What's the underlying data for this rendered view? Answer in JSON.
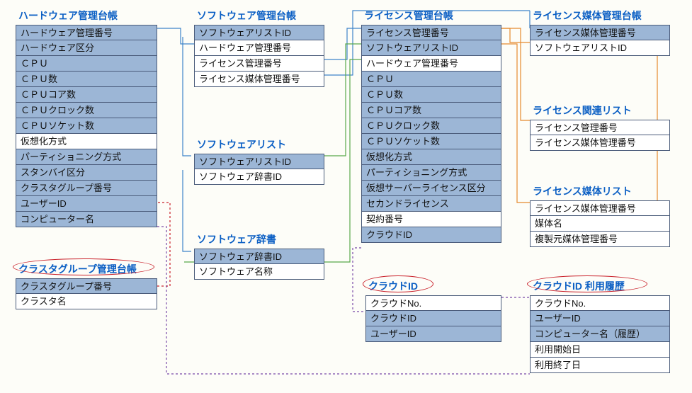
{
  "entities": {
    "hardware_ledger": {
      "title": "ハードウェア管理台帳",
      "fields": [
        {
          "label": "ハードウェア管理番号",
          "key": true
        },
        {
          "label": "ハードウェア区分",
          "key": true
        },
        {
          "label": "ＣＰＵ",
          "key": true
        },
        {
          "label": "ＣＰＵ数",
          "key": true
        },
        {
          "label": "ＣＰＵコア数",
          "key": true
        },
        {
          "label": "ＣＰＵクロック数",
          "key": true
        },
        {
          "label": "ＣＰＵソケット数",
          "key": true
        },
        {
          "label": "仮想化方式",
          "key": false
        },
        {
          "label": "パーティショニング方式",
          "key": true
        },
        {
          "label": "スタンバイ区分",
          "key": true
        },
        {
          "label": "クラスタグループ番号",
          "key": true
        },
        {
          "label": "ユーザーID",
          "key": true
        },
        {
          "label": "コンピューター名",
          "key": true
        }
      ]
    },
    "software_ledger": {
      "title": "ソフトウェア管理台帳",
      "fields": [
        {
          "label": "ソフトウェアリストID",
          "key": true
        },
        {
          "label": "ハードウェア管理番号",
          "key": false
        },
        {
          "label": "ライセンス管理番号",
          "key": false
        },
        {
          "label": "ライセンス媒体管理番号",
          "key": false
        }
      ]
    },
    "software_list": {
      "title": "ソフトウェアリスト",
      "fields": [
        {
          "label": "ソフトウェアリストID",
          "key": true
        },
        {
          "label": "ソフトウェア辞書ID",
          "key": false
        }
      ]
    },
    "software_dict": {
      "title": "ソフトウェア辞書",
      "fields": [
        {
          "label": "ソフトウェア辞書ID",
          "key": true
        },
        {
          "label": "ソフトウェア名称",
          "key": false
        }
      ]
    },
    "cluster_group": {
      "title": "クラスタグループ管理台帳",
      "fields": [
        {
          "label": "クラスタグループ番号",
          "key": true
        },
        {
          "label": "クラスタ名",
          "key": false
        }
      ]
    },
    "license_ledger": {
      "title": "ライセンス管理台帳",
      "fields": [
        {
          "label": "ライセンス管理番号",
          "key": true
        },
        {
          "label": "ソフトウェアリストID",
          "key": true
        },
        {
          "label": "ハードウェア管理番号",
          "key": false
        },
        {
          "label": "ＣＰＵ",
          "key": true
        },
        {
          "label": "ＣＰＵ数",
          "key": true
        },
        {
          "label": "ＣＰＵコア数",
          "key": true
        },
        {
          "label": "ＣＰＵクロック数",
          "key": true
        },
        {
          "label": "ＣＰＵソケット数",
          "key": true
        },
        {
          "label": "仮想化方式",
          "key": true
        },
        {
          "label": "パーティショニング方式",
          "key": true
        },
        {
          "label": "仮想サーバーライセンス区分",
          "key": true
        },
        {
          "label": "セカンドライセンス",
          "key": true
        },
        {
          "label": "契約番号",
          "key": false
        },
        {
          "label": "クラウドID",
          "key": true
        }
      ]
    },
    "license_media_ledger": {
      "title": "ライセンス媒体管理台帳",
      "fields": [
        {
          "label": "ライセンス媒体管理番号",
          "key": true
        },
        {
          "label": "ソフトウェアリストID",
          "key": false
        }
      ]
    },
    "license_related_list": {
      "title": "ライセンス関連リスト",
      "fields": [
        {
          "label": "ライセンス管理番号",
          "key": false
        },
        {
          "label": "ライセンス媒体管理番号",
          "key": false
        }
      ]
    },
    "license_media_list": {
      "title": "ライセンス媒体リスト",
      "fields": [
        {
          "label": "ライセンス媒体管理番号",
          "key": false
        },
        {
          "label": "媒体名",
          "key": false
        },
        {
          "label": "複製元媒体管理番号",
          "key": false
        }
      ]
    },
    "cloud_id": {
      "title": "クラウドID",
      "fields": [
        {
          "label": "クラウドNo.",
          "key": false
        },
        {
          "label": "クラウドID",
          "key": true
        },
        {
          "label": "ユーザーID",
          "key": true
        }
      ]
    },
    "cloud_id_history": {
      "title": "クラウドID 利用履歴",
      "fields": [
        {
          "label": "クラウドNo.",
          "key": false
        },
        {
          "label": "ユーザーID",
          "key": true
        },
        {
          "label": "コンピューター名（履歴）",
          "key": true
        },
        {
          "label": "利用開始日",
          "key": false
        },
        {
          "label": "利用終了日",
          "key": false
        }
      ]
    }
  }
}
